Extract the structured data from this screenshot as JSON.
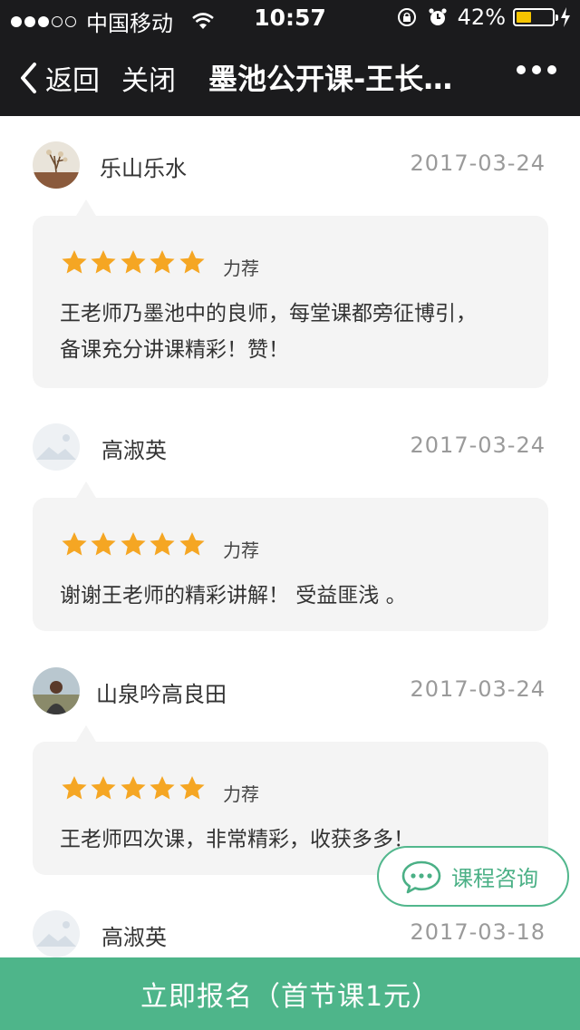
{
  "status_bar": {
    "carrier": "中国移动",
    "time": "10:57",
    "battery_percent": "42%",
    "battery_level": 0.42,
    "signal_bars_filled": 3,
    "signal_bars_total": 5
  },
  "nav": {
    "back_label": "返回",
    "close_label": "关闭",
    "title": "墨池公开课-王长…"
  },
  "reviews": [
    {
      "user": "乐山乐水",
      "date": "2017-03-24",
      "stars": 5,
      "rating_label": "力荐",
      "comment": "王老师乃墨池中的良师，每堂课都旁征博引，备课充分讲课精彩！赞！"
    },
    {
      "user": "高淑英",
      "date": "2017-03-24",
      "stars": 5,
      "rating_label": "力荐",
      "comment": "谢谢王老师的精彩讲解！ 受益匪浅 。"
    },
    {
      "user": "山泉吟高良田",
      "date": "2017-03-24",
      "stars": 5,
      "rating_label": "力荐",
      "comment": "王老师四次课，非常精彩，收获多多！"
    },
    {
      "user": "高淑英",
      "date": "2017-03-18"
    }
  ],
  "consult_button": {
    "label": "课程咨询"
  },
  "bottom_bar": {
    "label": "立即报名（首节课1元）"
  },
  "colors": {
    "star": "#f5a623",
    "accent_green": "#4eb58a",
    "nav_bg": "#1b1b1d"
  },
  "icons": {
    "back": "chevron-left-icon",
    "more": "more-dots-icon",
    "consult": "chat-bubble-icon",
    "wifi": "wifi-icon",
    "lock_rotation": "rotation-lock-icon",
    "alarm": "alarm-icon",
    "charging": "charging-bolt-icon"
  }
}
